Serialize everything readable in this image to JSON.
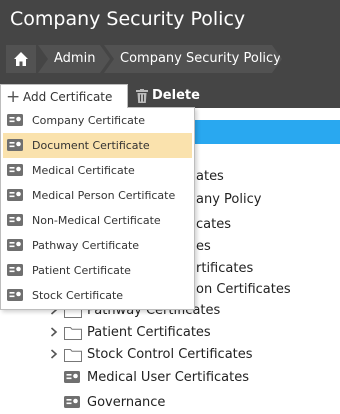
{
  "app": {
    "title": "Company Security Policy"
  },
  "breadcrumb": {
    "home_icon": "home-icon",
    "items": [
      "Admin",
      "Company Security Policy"
    ]
  },
  "toolbar": {
    "add_label": "Add Certificate",
    "add_icon": "plus-icon",
    "delete_label": "Delete",
    "delete_icon": "trash-icon"
  },
  "dropdown": {
    "highlight_color": "#fae2ad",
    "items": [
      {
        "label": "Company Certificate",
        "icon": "certificate-icon"
      },
      {
        "label": "Document Certificate",
        "icon": "certificate-icon",
        "highlighted": true
      },
      {
        "label": "Medical Certificate",
        "icon": "certificate-icon"
      },
      {
        "label": "Medical Person Certificate",
        "icon": "certificate-icon"
      },
      {
        "label": "Non-Medical Certificate",
        "icon": "certificate-icon"
      },
      {
        "label": "Pathway Certificate",
        "icon": "certificate-icon"
      },
      {
        "label": "Patient Certificate",
        "icon": "certificate-icon"
      },
      {
        "label": "Stock Certificate",
        "icon": "certificate-icon"
      }
    ]
  },
  "tree": {
    "selected_color": "#29a8f0",
    "partial_fragments": [
      "ates",
      "any Policy",
      "cates",
      "es",
      "rtificates",
      "on Certificates"
    ],
    "rows": [
      {
        "label": "Pathway Certificates",
        "icon": "folder-icon",
        "expandable": true
      },
      {
        "label": "Patient Certificates",
        "icon": "folder-icon",
        "expandable": true
      },
      {
        "label": "Stock Control Certificates",
        "icon": "folder-icon",
        "expandable": true
      },
      {
        "label": "Medical User Certificates",
        "icon": "certificate-icon",
        "expandable": false
      },
      {
        "label": "Governance",
        "icon": "certificate-icon",
        "expandable": false
      }
    ]
  },
  "colors": {
    "header_bg": "#454545",
    "crumb_bg": "#525252",
    "accent": "#29a8f0"
  }
}
